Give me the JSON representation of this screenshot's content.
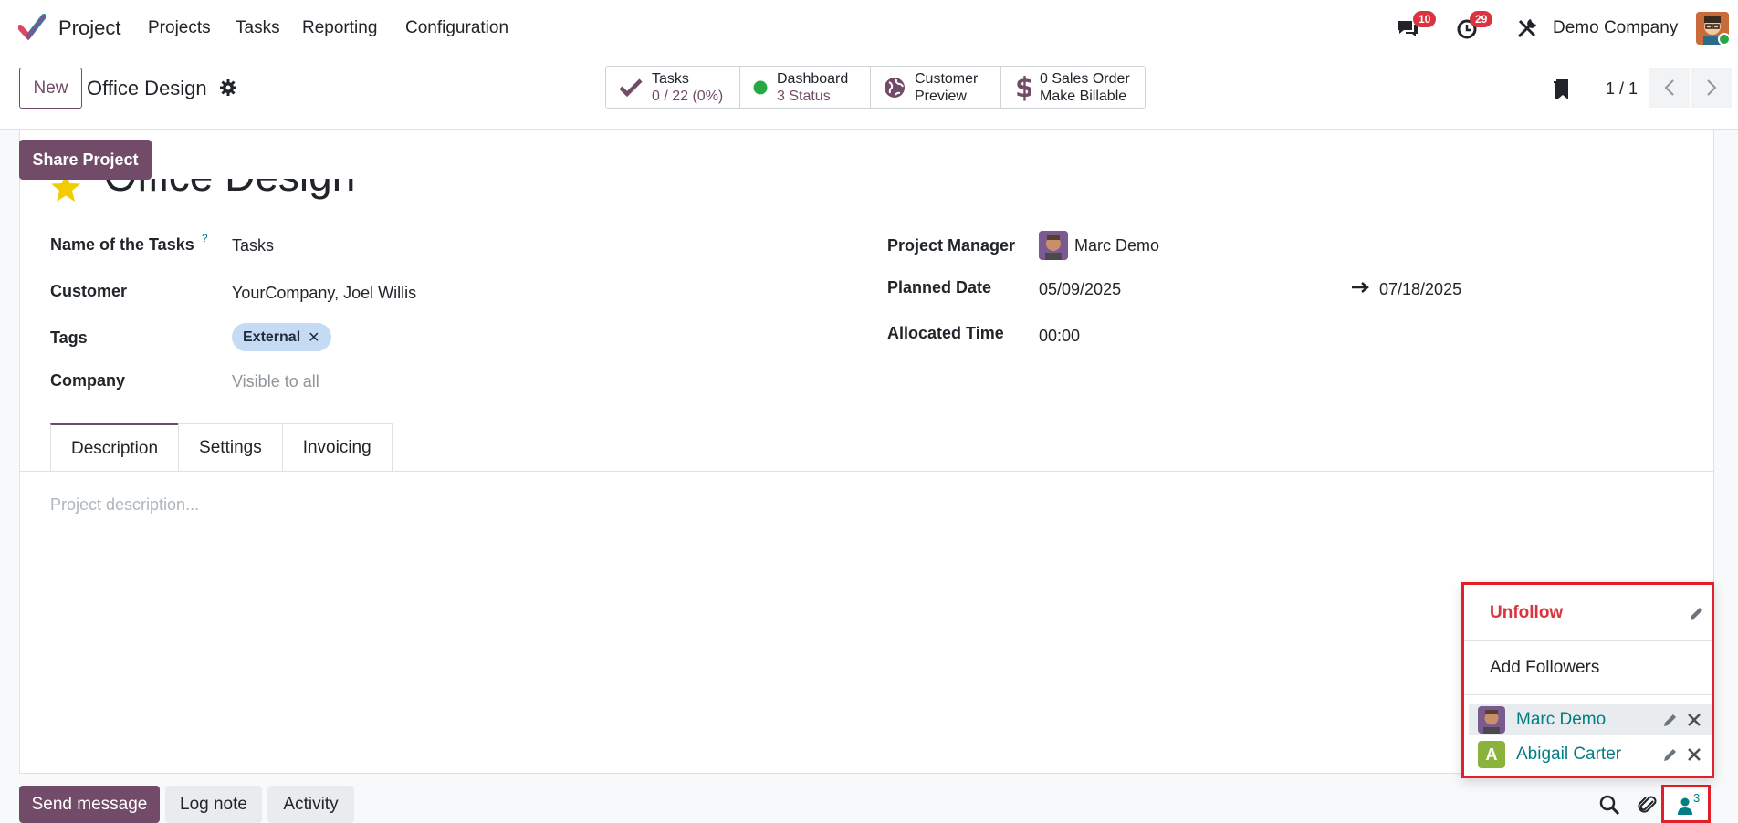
{
  "nav": {
    "app_name": "Project",
    "menu": [
      "Projects",
      "Tasks",
      "Reporting",
      "Configuration"
    ],
    "messages_count": "10",
    "activities_count": "29",
    "company": "Demo Company"
  },
  "control": {
    "new_label": "New",
    "record_name": "Office Design",
    "stats": [
      {
        "icon": "check-icon",
        "line1": "Tasks",
        "line2": "0 / 22 (0%)"
      },
      {
        "icon": "status-dot-icon",
        "line1": "Dashboard",
        "line2": "3 Status"
      },
      {
        "icon": "globe-icon",
        "line1": "Customer",
        "line2": "Preview"
      },
      {
        "icon": "dollar-icon",
        "line1": "0 Sales Order",
        "line2": "Make Billable"
      }
    ],
    "pager": "1 / 1"
  },
  "form": {
    "share_label": "Share Project",
    "title": "Office Design",
    "fields": {
      "tasks_label": "Name of the Tasks",
      "tasks_help": "?",
      "tasks_value": "Tasks",
      "customer_label": "Customer",
      "customer_value": "YourCompany, Joel Willis",
      "tags_label": "Tags",
      "tag_value": "External",
      "company_label": "Company",
      "company_value": "Visible to all",
      "manager_label": "Project Manager",
      "manager_value": "Marc Demo",
      "planned_label": "Planned Date",
      "planned_start": "05/09/2025",
      "planned_end": "07/18/2025",
      "allocated_label": "Allocated Time",
      "allocated_value": "00:00"
    },
    "tabs": [
      "Description",
      "Settings",
      "Invoicing"
    ],
    "description_placeholder": "Project description..."
  },
  "chatter": {
    "send_message": "Send message",
    "log_note": "Log note",
    "activity": "Activity",
    "followers_count": "3"
  },
  "followers_dropdown": {
    "unfollow": "Unfollow",
    "add_followers": "Add Followers",
    "followers": [
      {
        "name": "Marc Demo",
        "initial": "",
        "color": "#7a5a8f"
      },
      {
        "name": "Abigail Carter",
        "initial": "A",
        "color": "#8bb33c"
      }
    ]
  },
  "colors": {
    "brand": "#714b67",
    "link": "#017e84",
    "danger": "#d9343f",
    "highlight": "#e2202a"
  }
}
